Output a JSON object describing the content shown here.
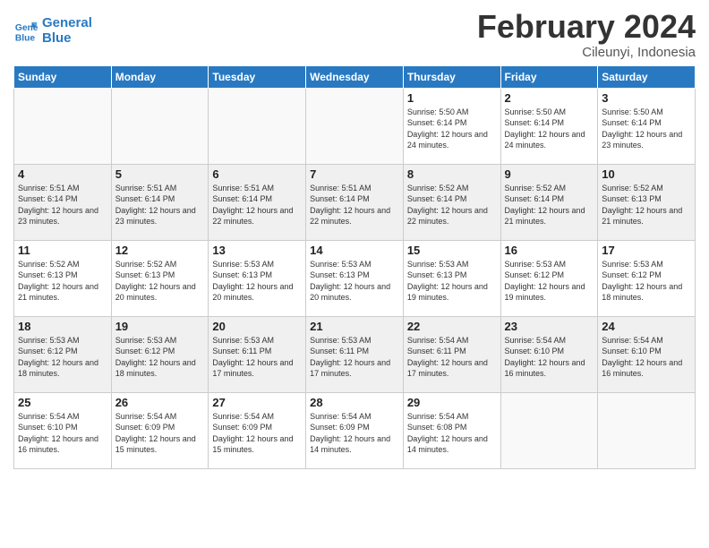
{
  "header": {
    "logo_line1": "General",
    "logo_line2": "Blue",
    "month": "February 2024",
    "location": "Cileunyi, Indonesia"
  },
  "days_of_week": [
    "Sunday",
    "Monday",
    "Tuesday",
    "Wednesday",
    "Thursday",
    "Friday",
    "Saturday"
  ],
  "weeks": [
    [
      {
        "day": null
      },
      {
        "day": null
      },
      {
        "day": null
      },
      {
        "day": null
      },
      {
        "day": "1",
        "sunrise": "Sunrise: 5:50 AM",
        "sunset": "Sunset: 6:14 PM",
        "daylight": "Daylight: 12 hours and 24 minutes."
      },
      {
        "day": "2",
        "sunrise": "Sunrise: 5:50 AM",
        "sunset": "Sunset: 6:14 PM",
        "daylight": "Daylight: 12 hours and 24 minutes."
      },
      {
        "day": "3",
        "sunrise": "Sunrise: 5:50 AM",
        "sunset": "Sunset: 6:14 PM",
        "daylight": "Daylight: 12 hours and 23 minutes."
      }
    ],
    [
      {
        "day": "4",
        "sunrise": "Sunrise: 5:51 AM",
        "sunset": "Sunset: 6:14 PM",
        "daylight": "Daylight: 12 hours and 23 minutes."
      },
      {
        "day": "5",
        "sunrise": "Sunrise: 5:51 AM",
        "sunset": "Sunset: 6:14 PM",
        "daylight": "Daylight: 12 hours and 23 minutes."
      },
      {
        "day": "6",
        "sunrise": "Sunrise: 5:51 AM",
        "sunset": "Sunset: 6:14 PM",
        "daylight": "Daylight: 12 hours and 22 minutes."
      },
      {
        "day": "7",
        "sunrise": "Sunrise: 5:51 AM",
        "sunset": "Sunset: 6:14 PM",
        "daylight": "Daylight: 12 hours and 22 minutes."
      },
      {
        "day": "8",
        "sunrise": "Sunrise: 5:52 AM",
        "sunset": "Sunset: 6:14 PM",
        "daylight": "Daylight: 12 hours and 22 minutes."
      },
      {
        "day": "9",
        "sunrise": "Sunrise: 5:52 AM",
        "sunset": "Sunset: 6:14 PM",
        "daylight": "Daylight: 12 hours and 21 minutes."
      },
      {
        "day": "10",
        "sunrise": "Sunrise: 5:52 AM",
        "sunset": "Sunset: 6:13 PM",
        "daylight": "Daylight: 12 hours and 21 minutes."
      }
    ],
    [
      {
        "day": "11",
        "sunrise": "Sunrise: 5:52 AM",
        "sunset": "Sunset: 6:13 PM",
        "daylight": "Daylight: 12 hours and 21 minutes."
      },
      {
        "day": "12",
        "sunrise": "Sunrise: 5:52 AM",
        "sunset": "Sunset: 6:13 PM",
        "daylight": "Daylight: 12 hours and 20 minutes."
      },
      {
        "day": "13",
        "sunrise": "Sunrise: 5:53 AM",
        "sunset": "Sunset: 6:13 PM",
        "daylight": "Daylight: 12 hours and 20 minutes."
      },
      {
        "day": "14",
        "sunrise": "Sunrise: 5:53 AM",
        "sunset": "Sunset: 6:13 PM",
        "daylight": "Daylight: 12 hours and 20 minutes."
      },
      {
        "day": "15",
        "sunrise": "Sunrise: 5:53 AM",
        "sunset": "Sunset: 6:13 PM",
        "daylight": "Daylight: 12 hours and 19 minutes."
      },
      {
        "day": "16",
        "sunrise": "Sunrise: 5:53 AM",
        "sunset": "Sunset: 6:12 PM",
        "daylight": "Daylight: 12 hours and 19 minutes."
      },
      {
        "day": "17",
        "sunrise": "Sunrise: 5:53 AM",
        "sunset": "Sunset: 6:12 PM",
        "daylight": "Daylight: 12 hours and 18 minutes."
      }
    ],
    [
      {
        "day": "18",
        "sunrise": "Sunrise: 5:53 AM",
        "sunset": "Sunset: 6:12 PM",
        "daylight": "Daylight: 12 hours and 18 minutes."
      },
      {
        "day": "19",
        "sunrise": "Sunrise: 5:53 AM",
        "sunset": "Sunset: 6:12 PM",
        "daylight": "Daylight: 12 hours and 18 minutes."
      },
      {
        "day": "20",
        "sunrise": "Sunrise: 5:53 AM",
        "sunset": "Sunset: 6:11 PM",
        "daylight": "Daylight: 12 hours and 17 minutes."
      },
      {
        "day": "21",
        "sunrise": "Sunrise: 5:53 AM",
        "sunset": "Sunset: 6:11 PM",
        "daylight": "Daylight: 12 hours and 17 minutes."
      },
      {
        "day": "22",
        "sunrise": "Sunrise: 5:54 AM",
        "sunset": "Sunset: 6:11 PM",
        "daylight": "Daylight: 12 hours and 17 minutes."
      },
      {
        "day": "23",
        "sunrise": "Sunrise: 5:54 AM",
        "sunset": "Sunset: 6:10 PM",
        "daylight": "Daylight: 12 hours and 16 minutes."
      },
      {
        "day": "24",
        "sunrise": "Sunrise: 5:54 AM",
        "sunset": "Sunset: 6:10 PM",
        "daylight": "Daylight: 12 hours and 16 minutes."
      }
    ],
    [
      {
        "day": "25",
        "sunrise": "Sunrise: 5:54 AM",
        "sunset": "Sunset: 6:10 PM",
        "daylight": "Daylight: 12 hours and 16 minutes."
      },
      {
        "day": "26",
        "sunrise": "Sunrise: 5:54 AM",
        "sunset": "Sunset: 6:09 PM",
        "daylight": "Daylight: 12 hours and 15 minutes."
      },
      {
        "day": "27",
        "sunrise": "Sunrise: 5:54 AM",
        "sunset": "Sunset: 6:09 PM",
        "daylight": "Daylight: 12 hours and 15 minutes."
      },
      {
        "day": "28",
        "sunrise": "Sunrise: 5:54 AM",
        "sunset": "Sunset: 6:09 PM",
        "daylight": "Daylight: 12 hours and 14 minutes."
      },
      {
        "day": "29",
        "sunrise": "Sunrise: 5:54 AM",
        "sunset": "Sunset: 6:08 PM",
        "daylight": "Daylight: 12 hours and 14 minutes."
      },
      {
        "day": null
      },
      {
        "day": null
      }
    ]
  ]
}
